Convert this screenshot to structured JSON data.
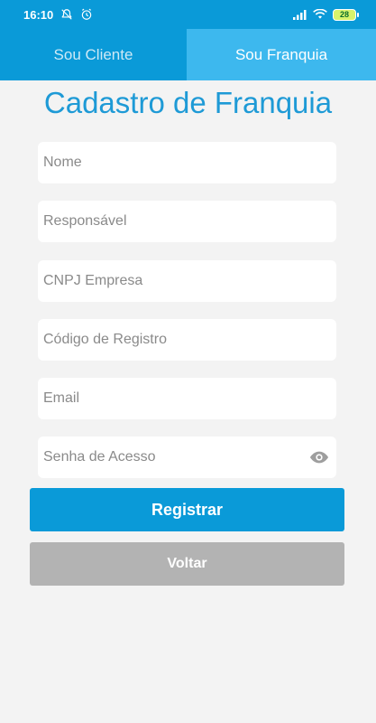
{
  "status_bar": {
    "time": "16:10",
    "battery_level": "28",
    "icons": [
      "notifications-off-icon",
      "alarm-icon",
      "signal-icon",
      "wifi-icon",
      "battery-icon"
    ]
  },
  "tabs": [
    {
      "label": "Sou Cliente",
      "active": false
    },
    {
      "label": "Sou Franquia",
      "active": true
    }
  ],
  "page": {
    "title": "Cadastro de Franquia"
  },
  "form": {
    "name_placeholder": "Nome",
    "responsible_placeholder": "Responsável",
    "cnpj_placeholder": "CNPJ Empresa",
    "registration_code_placeholder": "Código de Registro",
    "email_placeholder": "Email",
    "password_placeholder": "Senha de Acesso"
  },
  "buttons": {
    "register_label": "Registrar",
    "back_label": "Voltar"
  },
  "colors": {
    "primary": "#0a9ad8",
    "active_tab": "#3db8ee",
    "title": "#1e9ad6",
    "secondary_button": "#b3b3b3",
    "background": "#f3f3f3"
  }
}
